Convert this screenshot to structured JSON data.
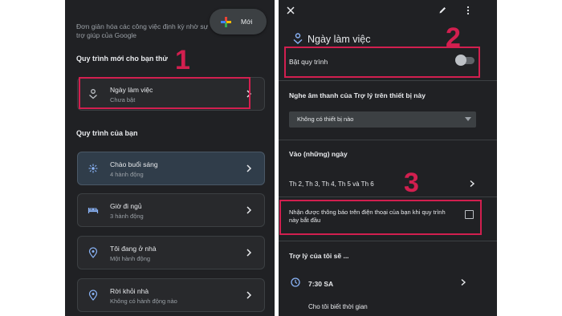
{
  "left": {
    "intro_text": "Đơn giản hóa các công việc định kỳ nhờ sự trợ giúp của Google",
    "new_button": {
      "label": "Mới",
      "icon": "plus-icon"
    },
    "suggested_heading": "Quy trình mới cho bạn thử",
    "suggested_routine": {
      "title": "Ngày làm việc",
      "subtitle": "Chưa bật",
      "icon": "work-icon"
    },
    "your_heading": "Quy trình của bạn",
    "routines": [
      {
        "title": "Chào buổi sáng",
        "subtitle": "4 hành động",
        "icon": "sunrise-icon"
      },
      {
        "title": "Giờ đi ngủ",
        "subtitle": "3 hành động",
        "icon": "bed-icon"
      },
      {
        "title": "Tôi đang ở nhà",
        "subtitle": "Một hành động",
        "icon": "location-icon"
      },
      {
        "title": "Rời khỏi nhà",
        "subtitle": "Không có hành động nào",
        "icon": "location-icon"
      }
    ]
  },
  "right": {
    "title": "Ngày làm việc",
    "enable_label": "Bật quy trình",
    "enable_state": "off",
    "audio_heading": "Nghe âm thanh của Trợ lý trên thiết bị này",
    "device_select_value": "Không có thiết bị nào",
    "days_heading": "Vào (những) ngày",
    "days_value": "Th 2, Th 3, Th 4, Th 5 và Th 6",
    "notify_text": "Nhận được thông báo trên điện thoại của bạn khi quy trình này bắt đầu",
    "notify_checked": false,
    "assistant_heading": "Trợ lý của tôi sẽ ...",
    "action_time": "7:30 SA",
    "action_text": "Cho tôi biết thời gian"
  },
  "annotations": {
    "one": "1",
    "two": "2",
    "three": "3"
  },
  "colors": {
    "panel_bg": "#202124",
    "annotation_red": "#d21f4f",
    "active_card": "#303d4a",
    "accent_blue": "#8ab4f8"
  }
}
